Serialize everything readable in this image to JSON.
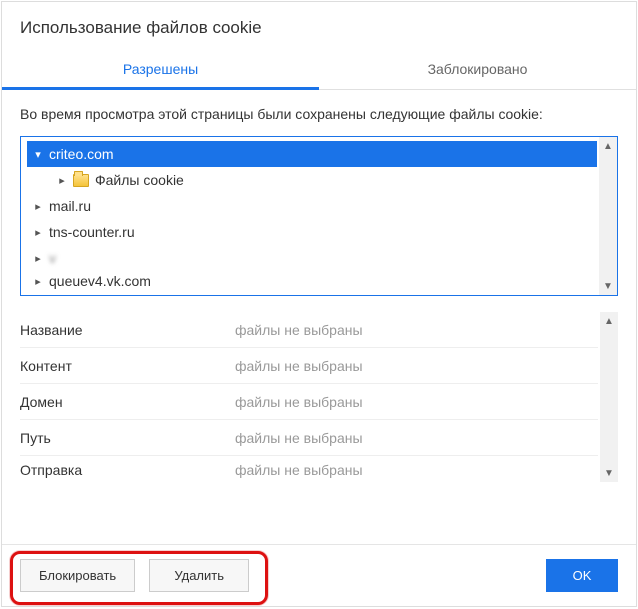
{
  "title": "Использование файлов cookie",
  "tabs": {
    "allowed": "Разрешены",
    "blocked": "Заблокировано"
  },
  "intro": "Во время просмотра этой страницы были сохранены следующие файлы cookie:",
  "tree": {
    "items": [
      {
        "label": "criteo.com",
        "expanded": true,
        "selected": true
      },
      {
        "label": "Файлы cookie",
        "child": true
      },
      {
        "label": "mail.ru"
      },
      {
        "label": "tns-counter.ru"
      },
      {
        "label": "v",
        "blurred": true
      },
      {
        "label": "queuev4.vk.com",
        "cut": true
      }
    ]
  },
  "details": {
    "not_selected": "файлы не выбраны",
    "rows": [
      {
        "label": "Название"
      },
      {
        "label": "Контент"
      },
      {
        "label": "Домен"
      },
      {
        "label": "Путь"
      },
      {
        "label": "Отправка",
        "cut": true
      }
    ]
  },
  "footer": {
    "block": "Блокировать",
    "delete": "Удалить",
    "ok": "OK"
  }
}
